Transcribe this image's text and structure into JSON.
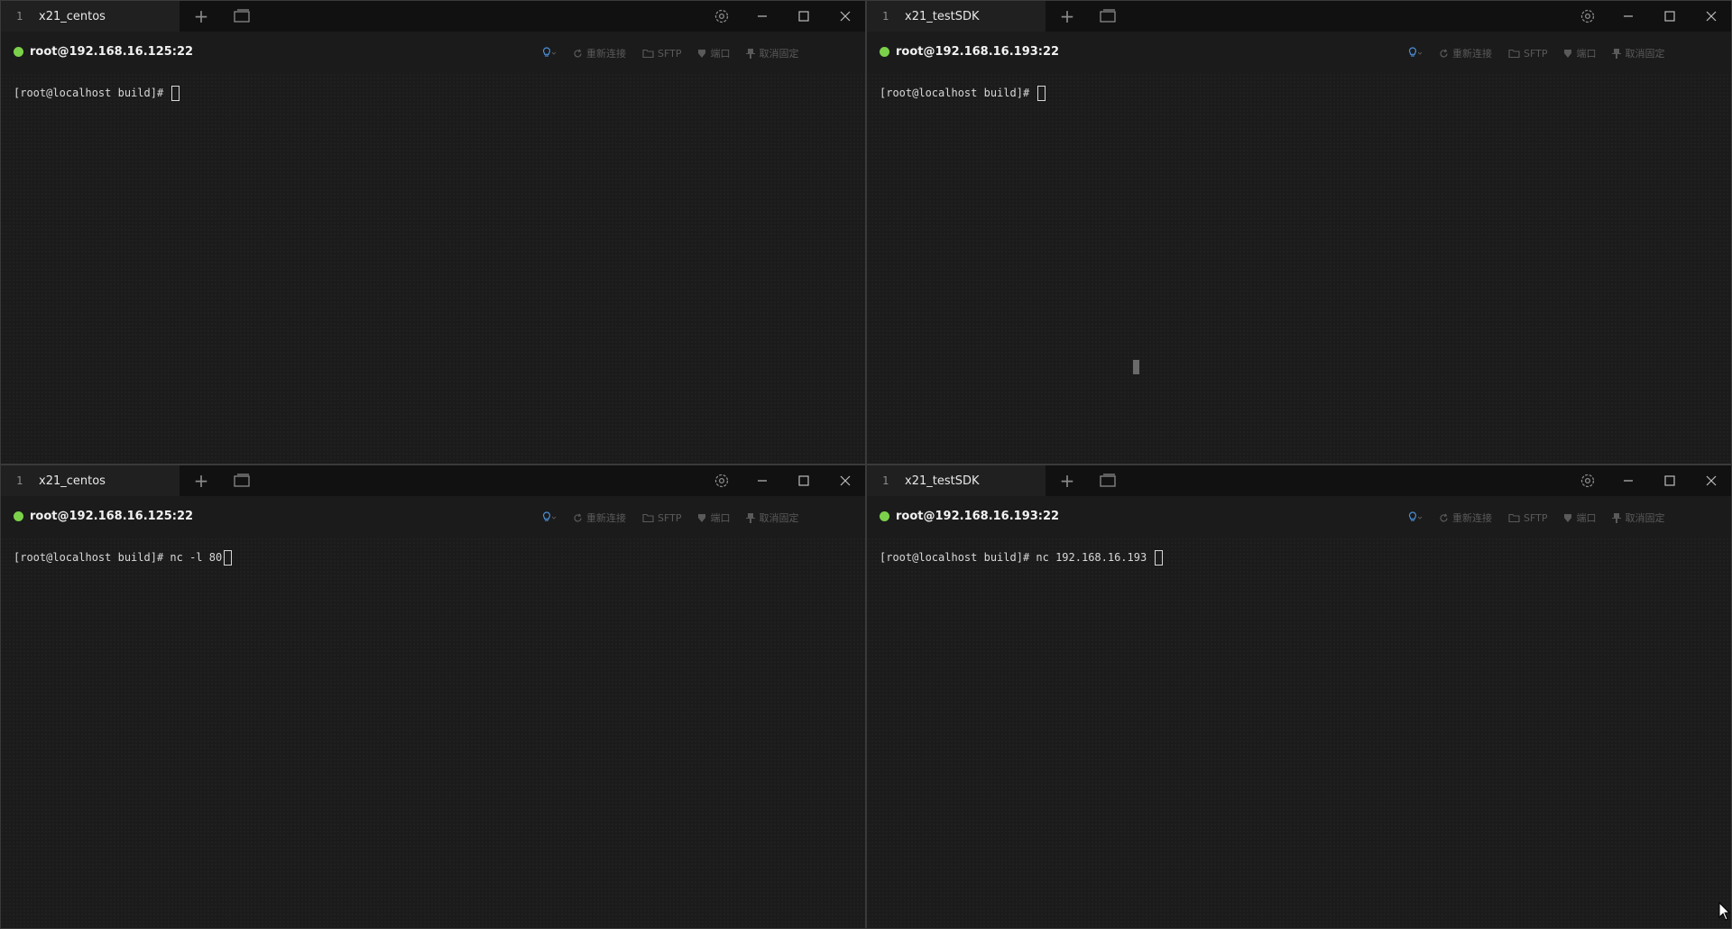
{
  "panes": [
    {
      "tab": {
        "index": "1",
        "title": "x21_centos"
      },
      "host": "root@192.168.16.125:22",
      "toolbar": {
        "reconnect": "重新连接",
        "sftp": "SFTP",
        "port": "端口",
        "unpin": "取消固定"
      },
      "terminal": {
        "prompt": "[root@localhost build]# ",
        "command": ""
      }
    },
    {
      "tab": {
        "index": "1",
        "title": "x21_testSDK"
      },
      "host": "root@192.168.16.193:22",
      "toolbar": {
        "reconnect": "重新连接",
        "sftp": "SFTP",
        "port": "端口",
        "unpin": "取消固定"
      },
      "terminal": {
        "prompt": "[root@localhost build]# ",
        "command": ""
      }
    },
    {
      "tab": {
        "index": "1",
        "title": "x21_centos"
      },
      "host": "root@192.168.16.125:22",
      "toolbar": {
        "reconnect": "重新连接",
        "sftp": "SFTP",
        "port": "端口",
        "unpin": "取消固定"
      },
      "terminal": {
        "prompt": "[root@localhost build]# ",
        "command": "nc -l 80"
      }
    },
    {
      "tab": {
        "index": "1",
        "title": "x21_testSDK"
      },
      "host": "root@192.168.16.193:22",
      "toolbar": {
        "reconnect": "重新连接",
        "sftp": "SFTP",
        "port": "端口",
        "unpin": "取消固定"
      },
      "terminal": {
        "prompt": "[root@localhost build]# ",
        "command": "nc 192.168.16.193 "
      }
    }
  ],
  "colors": {
    "status_connected": "#7cd14a",
    "bulb": "#4a8fd8",
    "background": "#1b1b1b"
  },
  "icons": [
    "add-icon",
    "windows-icon",
    "gear-icon",
    "minimize-icon",
    "maximize-icon",
    "close-icon",
    "bulb-icon",
    "reconnect-icon",
    "folder-icon",
    "port-icon",
    "pin-icon"
  ]
}
